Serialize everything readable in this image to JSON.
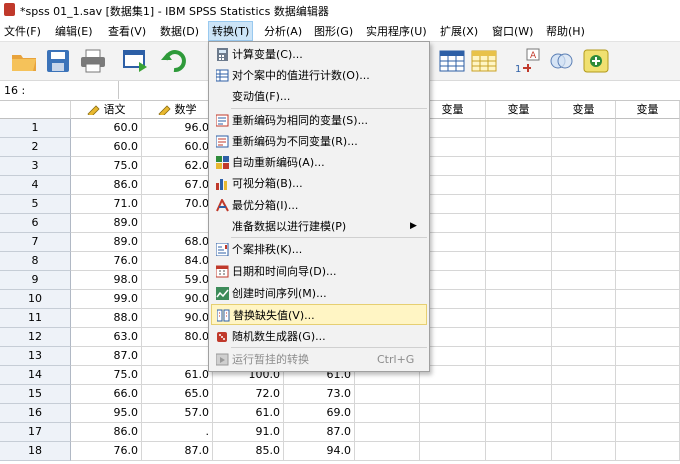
{
  "window": {
    "title": "*spss 01_1.sav [数据集1] - IBM SPSS Statistics 数据编辑器"
  },
  "menubar": [
    {
      "label": "文件(F)"
    },
    {
      "label": "编辑(E)"
    },
    {
      "label": "查看(V)"
    },
    {
      "label": "数据(D)"
    },
    {
      "label": "转换(T)"
    },
    {
      "label": "分析(A)"
    },
    {
      "label": "图形(G)"
    },
    {
      "label": "实用程序(U)"
    },
    {
      "label": "扩展(X)"
    },
    {
      "label": "窗口(W)"
    },
    {
      "label": "帮助(H)"
    }
  ],
  "active_menu": "转换(T)",
  "cellbar": {
    "ref": "16 :"
  },
  "columns": [
    "语文",
    "数学",
    "变量",
    "变量",
    "变量",
    "变量",
    "变量",
    "变量"
  ],
  "rows": [
    {
      "n": "1",
      "c": [
        "60.0",
        "96.0",
        "",
        ""
      ]
    },
    {
      "n": "2",
      "c": [
        "60.0",
        "60.0",
        "",
        ""
      ]
    },
    {
      "n": "3",
      "c": [
        "75.0",
        "62.0",
        "",
        ""
      ]
    },
    {
      "n": "4",
      "c": [
        "86.0",
        "67.0",
        "",
        ""
      ]
    },
    {
      "n": "5",
      "c": [
        "71.0",
        "70.0",
        "",
        ""
      ]
    },
    {
      "n": "6",
      "c": [
        "89.0",
        "",
        "",
        ""
      ]
    },
    {
      "n": "7",
      "c": [
        "89.0",
        "68.0",
        "",
        ""
      ]
    },
    {
      "n": "8",
      "c": [
        "76.0",
        "84.0",
        "",
        ""
      ]
    },
    {
      "n": "9",
      "c": [
        "98.0",
        "59.0",
        "",
        ""
      ]
    },
    {
      "n": "10",
      "c": [
        "99.0",
        "90.0",
        "",
        ""
      ]
    },
    {
      "n": "11",
      "c": [
        "88.0",
        "90.0",
        "",
        ""
      ]
    },
    {
      "n": "12",
      "c": [
        "63.0",
        "80.0",
        "",
        ""
      ]
    },
    {
      "n": "13",
      "c": [
        "87.0",
        "",
        "",
        ""
      ]
    },
    {
      "n": "14",
      "c": [
        "75.0",
        "61.0",
        "100.0",
        "61.0"
      ]
    },
    {
      "n": "15",
      "c": [
        "66.0",
        "65.0",
        "72.0",
        "73.0"
      ]
    },
    {
      "n": "16",
      "c": [
        "95.0",
        "57.0",
        "61.0",
        "69.0"
      ]
    },
    {
      "n": "17",
      "c": [
        "86.0",
        ".",
        "91.0",
        "87.0"
      ]
    },
    {
      "n": "18",
      "c": [
        "76.0",
        "87.0",
        "85.0",
        "94.0"
      ]
    }
  ],
  "menu": {
    "items": [
      {
        "label": "计算变量(C)...",
        "icon": "calculator-icon"
      },
      {
        "label": "对个案中的值进行计数(O)...",
        "icon": "count-icon"
      },
      {
        "label": "变动值(F)...",
        "icon": ""
      },
      {
        "label": "重新编码为相同的变量(S)...",
        "icon": "recode-same-icon"
      },
      {
        "label": "重新编码为不同变量(R)...",
        "icon": "recode-different-icon"
      },
      {
        "label": "自动重新编码(A)...",
        "icon": "auto-recode-icon"
      },
      {
        "label": "可视分箱(B)...",
        "icon": "visual-binning-icon"
      },
      {
        "label": "最优分箱(I)...",
        "icon": "optimal-binning-icon"
      },
      {
        "label": "准备数据以进行建模(P)",
        "icon": ""
      },
      {
        "label": "个案排秩(K)...",
        "icon": "rank-cases-icon"
      },
      {
        "label": "日期和时间向导(D)...",
        "icon": "date-time-icon"
      },
      {
        "label": "创建时间序列(M)...",
        "icon": "time-series-icon"
      },
      {
        "label": "替换缺失值(V)...",
        "icon": "replace-missing-icon"
      },
      {
        "label": "随机数生成器(G)...",
        "icon": "random-dice-icon"
      },
      {
        "label": "运行暂挂的转换",
        "icon": "run-pending-icon"
      }
    ],
    "submenu_arrow": "▶",
    "run_pending_shortcut": "Ctrl+G",
    "highlighted": "替换缺失值(V)..."
  }
}
